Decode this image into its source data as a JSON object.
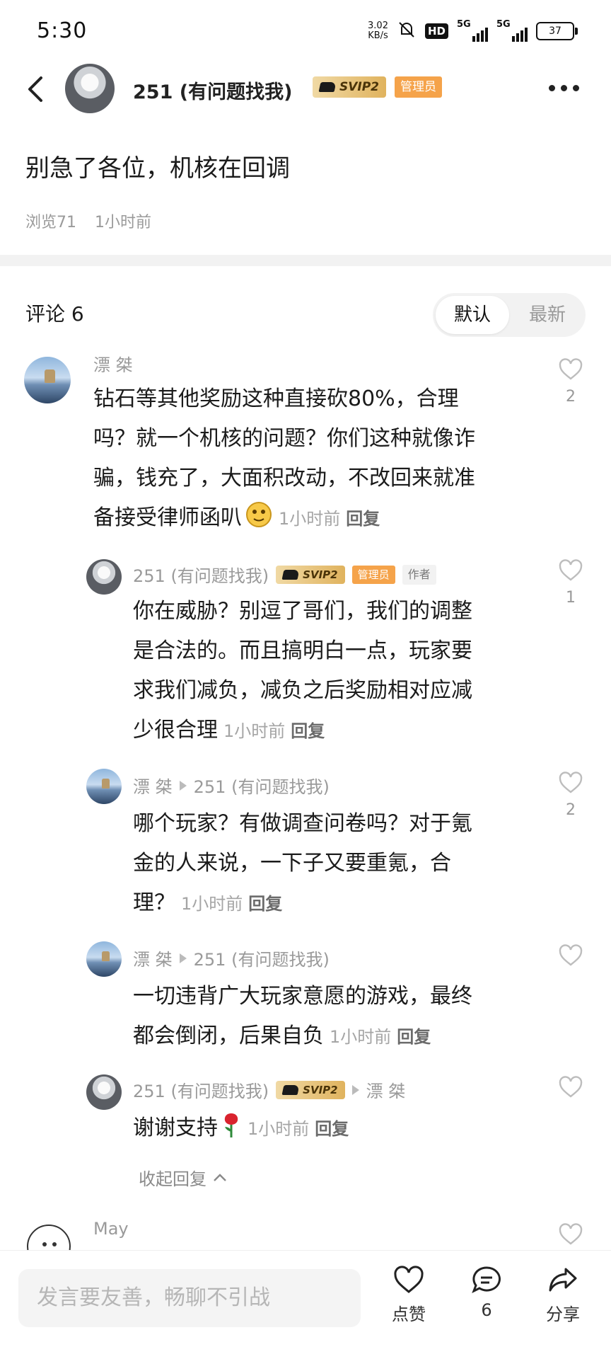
{
  "status": {
    "time": "5:30",
    "net_speed_value": "3.02",
    "net_speed_unit": "KB/s",
    "hd": "HD",
    "signal1": "5G",
    "signal2": "5G",
    "battery": "37"
  },
  "header": {
    "name": "251 (有问题找我)",
    "svip": "SVIP2",
    "admin": "管理员"
  },
  "post": {
    "title": "别急了各位，机核在回调",
    "views": "浏览71",
    "time": "1小时前"
  },
  "comments_header": {
    "label": "评论 6",
    "sort_default": "默认",
    "sort_newest": "最新"
  },
  "comments": [
    {
      "user": "漂 桀",
      "line1": "钻石等其他奖励这种直接砍80%，合理",
      "line2": "吗？就一个机核的问题？你们这种就像诈",
      "line3": "骗，钱充了，大面积改动，不改回来就准",
      "line4": "备接受律师函叭",
      "time": "1小时前",
      "reply": "回复",
      "likes": "2"
    },
    {
      "user": "251 (有问题找我)",
      "svip": "SVIP2",
      "admin": "管理员",
      "author": "作者",
      "line1": "你在威胁？别逗了哥们，我们的调整",
      "line2": "是合法的。而且搞明白一点，玩家要",
      "line3": "求我们减负，减负之后奖励相对应减",
      "line4": "少很合理",
      "time": "1小时前",
      "reply": "回复",
      "likes": "1"
    },
    {
      "user": "漂 桀",
      "target": "251 (有问题找我)",
      "line1": "哪个玩家？有做调查问卷吗？对于氪",
      "line2": "金的人来说，一下子又要重氪，合",
      "line3": "理？",
      "time": "1小时前",
      "reply": "回复",
      "likes": "2"
    },
    {
      "user": "漂 桀",
      "target": "251 (有问题找我)",
      "line1": "一切违背广大玩家意愿的游戏，最终",
      "line2": "都会倒闭，后果自负",
      "time": "1小时前",
      "reply": "回复"
    },
    {
      "user": "251 (有问题找我)",
      "svip": "SVIP2",
      "target": "漂 桀",
      "line1": "谢谢支持",
      "time": "1小时前",
      "reply": "回复"
    },
    {
      "user": "May"
    }
  ],
  "collapse_label": "收起回复",
  "bottom_bar": {
    "input_placeholder": "发言要友善，畅聊不引战",
    "like_label": "点赞",
    "comment_count": "6",
    "share_label": "分享"
  },
  "icons": {
    "back": "chevron-left-icon",
    "more": "more-dots-icon",
    "like": "heart-icon",
    "comment": "comment-bubble-icon",
    "share": "share-arrow-icon"
  }
}
